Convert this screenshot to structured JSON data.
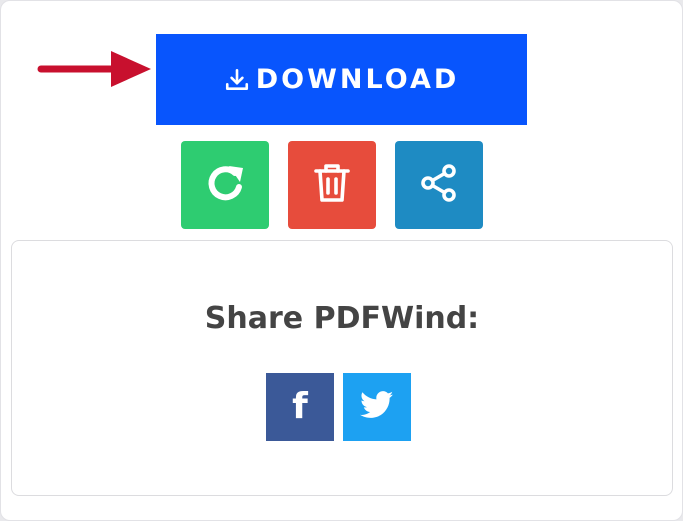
{
  "download": {
    "label": "DOWNLOAD",
    "icon": "download-icon",
    "color": "#0855fd"
  },
  "annotation": {
    "arrow_color": "#c8102e"
  },
  "actions": [
    {
      "name": "restart",
      "icon": "rotate-icon",
      "color": "#2ecc71"
    },
    {
      "name": "delete",
      "icon": "trash-icon",
      "color": "#e74c3c"
    },
    {
      "name": "share",
      "icon": "share-icon",
      "color": "#1e8bc3"
    }
  ],
  "share_panel": {
    "title": "Share PDFWind:",
    "buttons": [
      {
        "network": "facebook",
        "icon": "facebook-icon",
        "glyph": "f",
        "color": "#3b5998"
      },
      {
        "network": "twitter",
        "icon": "twitter-icon",
        "color": "#1da1f2"
      }
    ]
  }
}
